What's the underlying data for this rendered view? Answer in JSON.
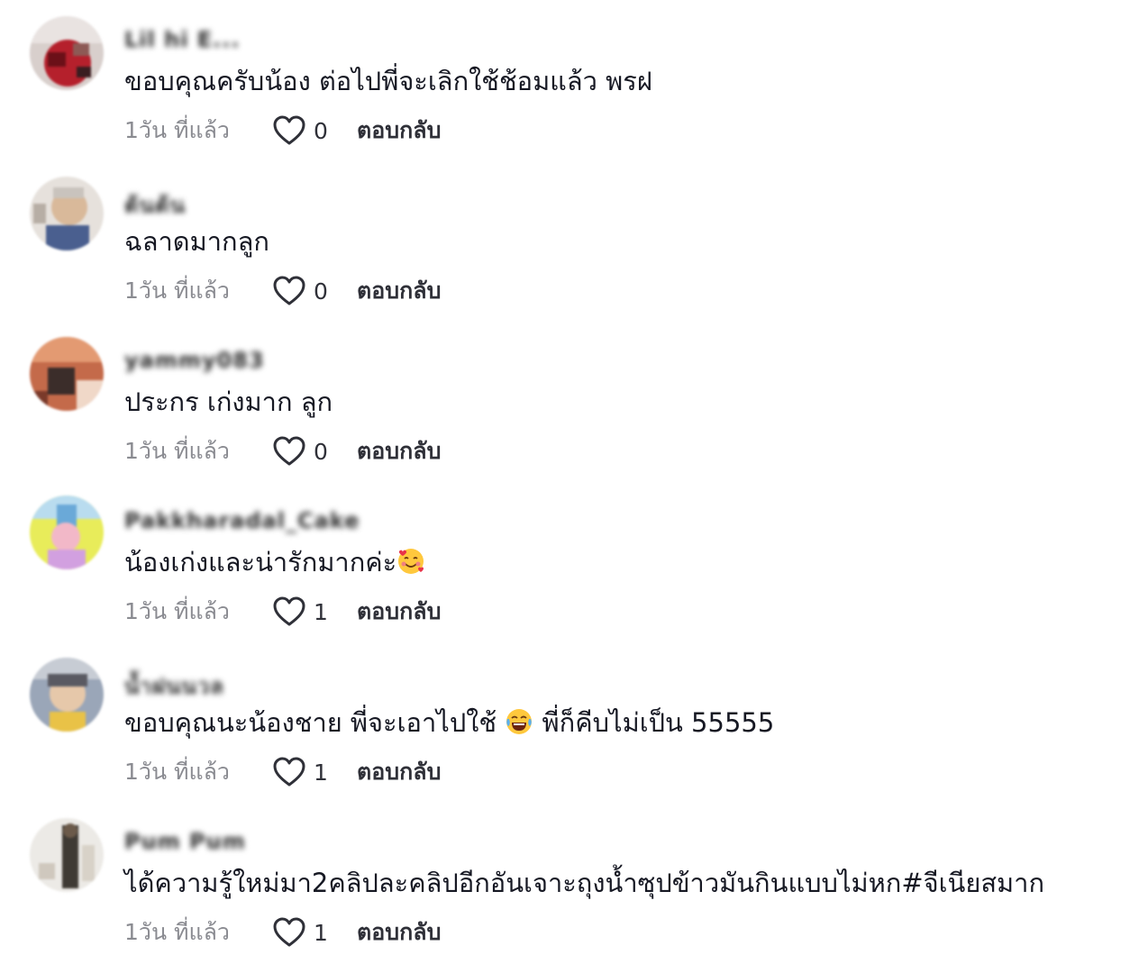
{
  "comments": [
    {
      "username": "Lil hi E...",
      "text": "ขอบคุณครับน้อง ต่อไปพี่จะเลิกใช้ช้อมแล้ว พรฝ",
      "time": "1วัน ที่แล้ว",
      "likes": "0",
      "reply": "ตอบกลับ"
    },
    {
      "username": "ต้นต้น",
      "text": "ฉลาดมากลูก",
      "time": "1วัน ที่แล้ว",
      "likes": "0",
      "reply": "ตอบกลับ"
    },
    {
      "username": "yammy083",
      "text": "ประกร เก่งมาก ลูก",
      "time": "1วัน ที่แล้ว",
      "likes": "0",
      "reply": "ตอบกลับ"
    },
    {
      "username": "Pakkharadal_Cake",
      "text": "น้องเก่งและน่ารักมากค่ะ",
      "emoji": "smiling-face-with-hearts-icon",
      "time": "1วัน ที่แล้ว",
      "likes": "1",
      "reply": "ตอบกลับ"
    },
    {
      "username": "น้ำฝนนวล",
      "text_before": "ขอบคุณนะน้องชาย พี่จะเอาไปใช้",
      "emoji": "face-with-tears-of-joy-icon",
      "text_after": "พี่ก็คีบไม่เป็น 55555",
      "time": "1วัน ที่แล้ว",
      "likes": "1",
      "reply": "ตอบกลับ"
    },
    {
      "username": "Pum Pum",
      "text": "ได้ความรู้ใหม่มา2คลิปละคลิปอีกอันเจาะถุงน้ำซุปข้าวมันกินแบบไม่หก#จีเนียสมาก",
      "time": "1วัน ที่แล้ว",
      "likes": "1",
      "reply": "ตอบกลับ"
    }
  ],
  "colors": {
    "text": "#161823",
    "muted": "#8a8b91",
    "icon": "#2f3038"
  }
}
